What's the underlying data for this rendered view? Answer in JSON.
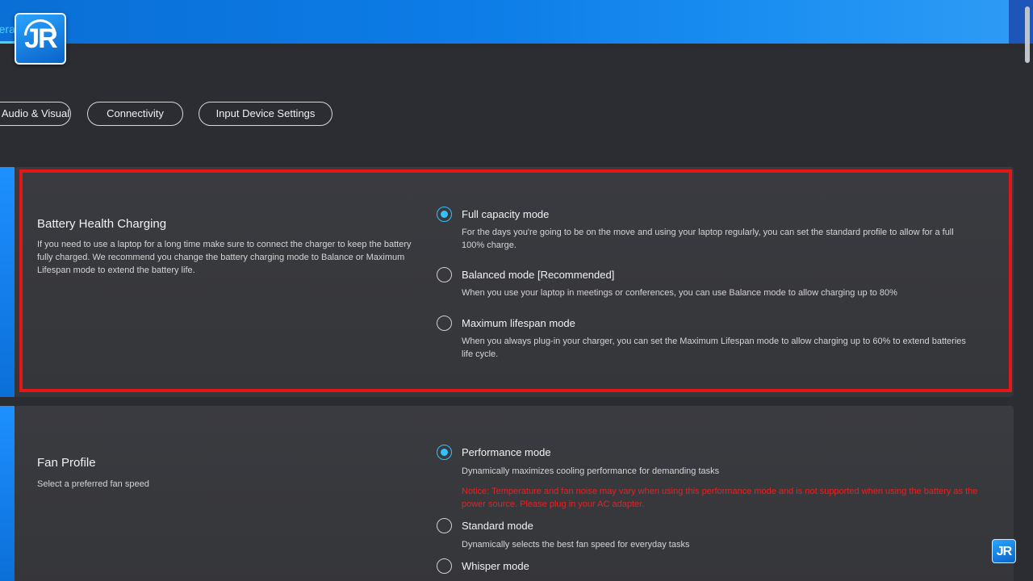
{
  "topbar": {
    "tab_label": "General"
  },
  "logo": {
    "text": "JR"
  },
  "tabs": [
    {
      "label": "Audio & Visual"
    },
    {
      "label": "Connectivity"
    },
    {
      "label": "Input Device Settings"
    }
  ],
  "battery": {
    "title": "Battery Health Charging",
    "description": "If you need to use a laptop for a long time make sure to connect the charger to keep the battery fully charged. We recommend you change the battery charging mode to Balance or Maximum Lifespan mode to extend the battery life.",
    "options": [
      {
        "label": "Full capacity mode",
        "description": "For the days you're going to be on the move and using your laptop regularly, you can set the standard profile to allow for a full 100% charge.",
        "selected": true
      },
      {
        "label": "Balanced mode [Recommended]",
        "description": "When you use your laptop in meetings or conferences, you can use Balance mode to allow charging up to 80%",
        "selected": false
      },
      {
        "label": "Maximum lifespan mode",
        "description": "When you always plug-in your charger, you can set the Maximum Lifespan mode to allow charging up to 60% to extend batteries life cycle.",
        "selected": false
      }
    ]
  },
  "fan": {
    "title": "Fan Profile",
    "description": "Select a preferred fan speed",
    "options": [
      {
        "label": "Performance mode",
        "description": "Dynamically maximizes cooling performance for demanding tasks",
        "note": "Notice: Temperature and fan noise may vary when using this performance mode and is not supported when using the battery as the power source. Please plug in your AC adapter.",
        "selected": true
      },
      {
        "label": "Standard mode",
        "description": "Dynamically selects the best fan speed for everyday tasks",
        "selected": false
      },
      {
        "label": "Whisper mode",
        "selected": false
      }
    ]
  },
  "watermark": {
    "text": "JR"
  },
  "colors": {
    "accent": "#35c0ff",
    "highlight": "#e01818",
    "note": "#e52222"
  }
}
